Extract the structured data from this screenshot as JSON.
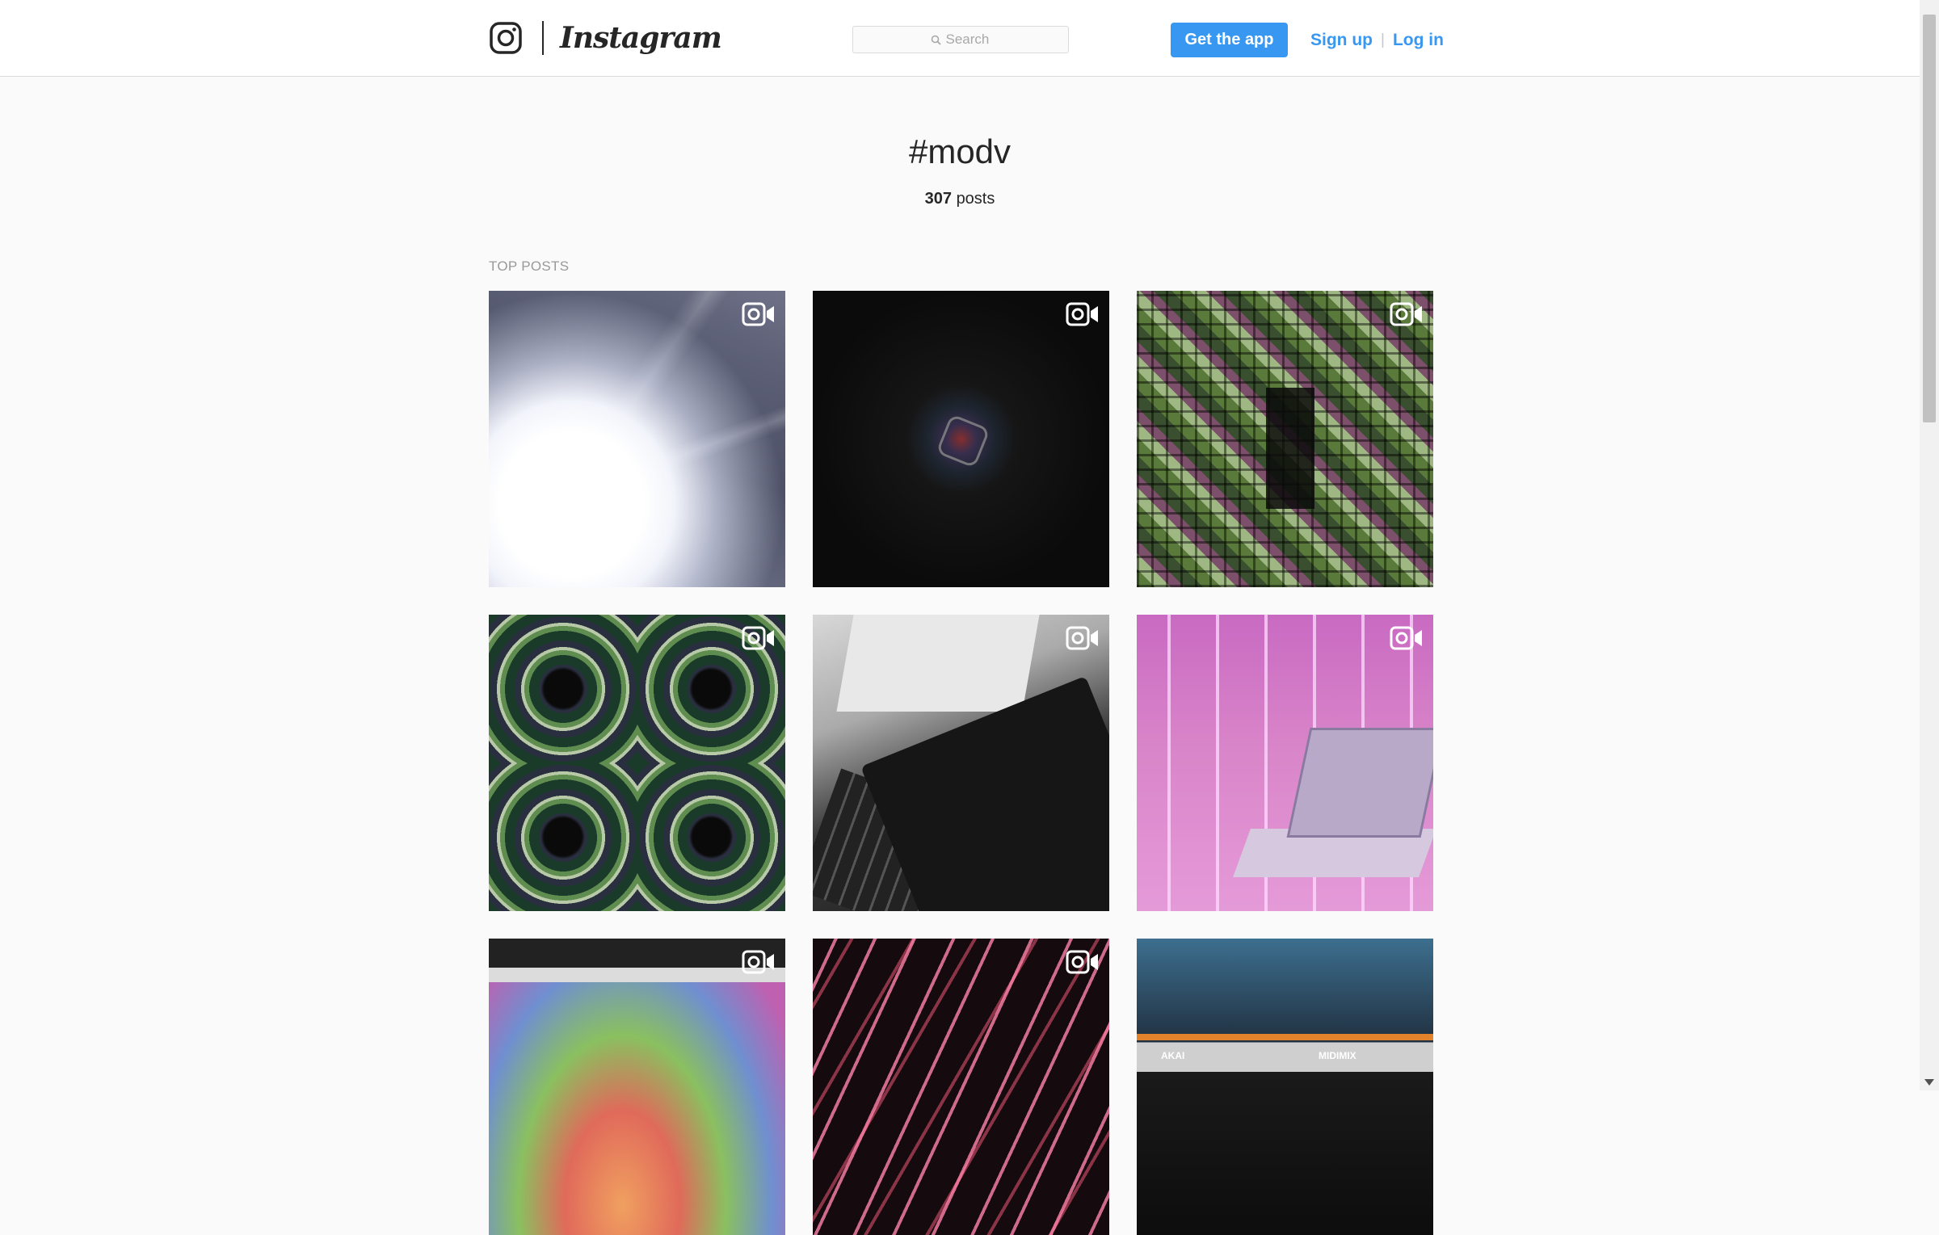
{
  "header": {
    "brand": "Instagram",
    "search": {
      "placeholder": "Search"
    },
    "get_app_label": "Get the app",
    "sign_up_label": "Sign up",
    "separator": "|",
    "log_in_label": "Log in"
  },
  "hashtag": {
    "title": "#modv",
    "post_count": "307",
    "post_count_suffix": "posts"
  },
  "section_label": "TOP POSTS",
  "posts": [
    {
      "type": "video",
      "icon": "video-camera-icon"
    },
    {
      "type": "video",
      "icon": "video-camera-icon"
    },
    {
      "type": "video",
      "icon": "video-camera-icon"
    },
    {
      "type": "video",
      "icon": "video-camera-icon"
    },
    {
      "type": "video",
      "icon": "video-camera-icon"
    },
    {
      "type": "video",
      "icon": "video-camera-icon"
    },
    {
      "type": "video",
      "icon": "video-camera-icon"
    },
    {
      "type": "video",
      "icon": "video-camera-icon"
    },
    {
      "type": "photo"
    }
  ],
  "photo_text": {
    "akai": "AKAI",
    "midimix": "MIDIMIX"
  },
  "colors": {
    "accent": "#3897f0",
    "text": "#262626",
    "muted": "#999999",
    "page_bg": "#fafafa",
    "border": "#dbdbdb"
  }
}
